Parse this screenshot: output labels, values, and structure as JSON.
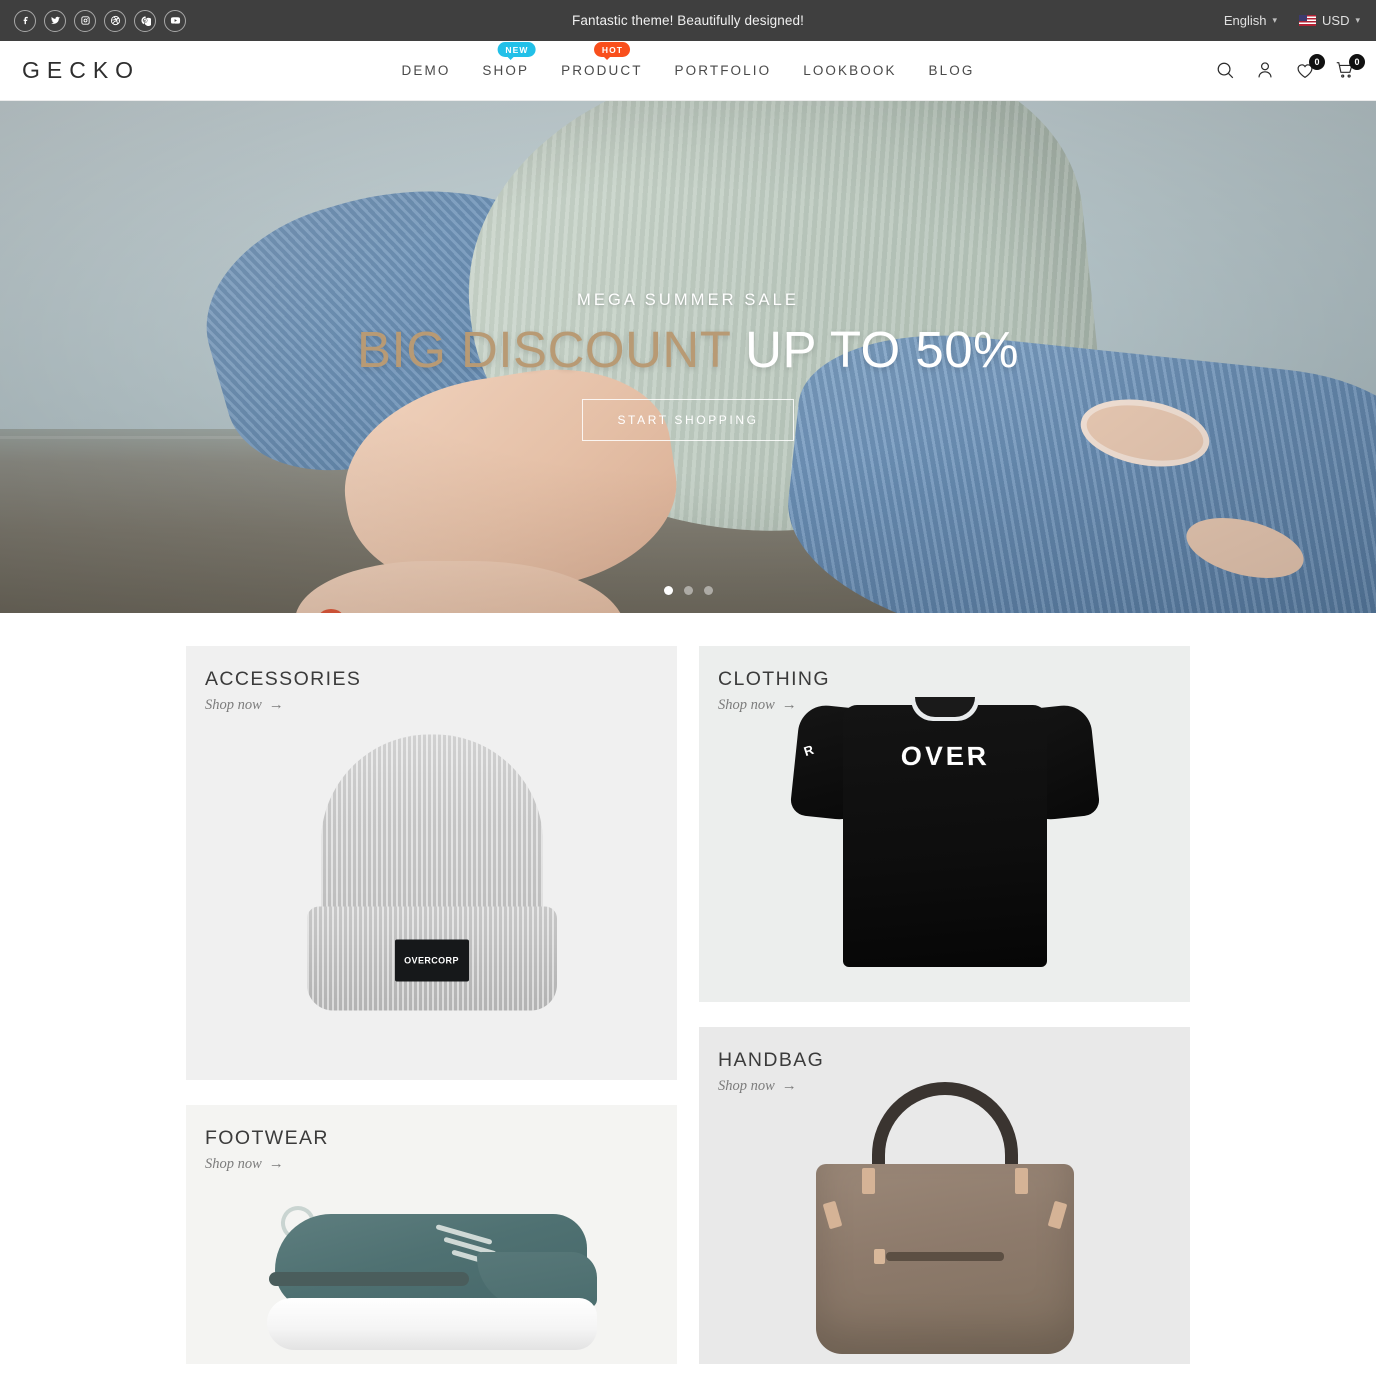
{
  "topbar": {
    "message": "Fantastic theme! Beautifully designed!",
    "social": [
      {
        "name": "facebook-icon",
        "label": "f"
      },
      {
        "name": "twitter-icon",
        "label": "t"
      },
      {
        "name": "instagram-icon",
        "label": "ig"
      },
      {
        "name": "dribbble-icon",
        "label": "d"
      },
      {
        "name": "pinterest-icon",
        "label": "p"
      },
      {
        "name": "youtube-icon",
        "label": "yt"
      }
    ],
    "language": "English",
    "currency": "USD",
    "bg_color": "#3f3f3f"
  },
  "header": {
    "logo": "GECKO",
    "nav": [
      {
        "label": "DEMO",
        "badge": null
      },
      {
        "label": "SHOP",
        "badge": "NEW",
        "badge_color": "#22c0e8"
      },
      {
        "label": "PRODUCT",
        "badge": "HOT",
        "badge_color": "#f94f1c"
      },
      {
        "label": "PORTFOLIO",
        "badge": null
      },
      {
        "label": "LOOKBOOK",
        "badge": null
      },
      {
        "label": "BLOG",
        "badge": null
      }
    ],
    "icons": [
      {
        "name": "search-icon",
        "count": null
      },
      {
        "name": "account-icon",
        "count": null
      },
      {
        "name": "wishlist-heart-icon",
        "count": "0"
      },
      {
        "name": "cart-icon",
        "count": "0"
      }
    ]
  },
  "hero": {
    "subtitle": "MEGA SUMMER SALE",
    "title_accent": "BIG DISCOUNT",
    "title_main": "UP TO 50%",
    "button": "START SHOPPING",
    "accent_color": "#b89a74",
    "slides": 3,
    "active_slide": 1
  },
  "categories": [
    {
      "title": "ACCESSORIES",
      "link": "Shop now",
      "arrow": "→",
      "bg": "#f0f0f0",
      "product": "gray-beanie",
      "product_label": "OVERCORP"
    },
    {
      "title": "CLOTHING",
      "link": "Shop now",
      "arrow": "→",
      "bg": "#eceeed",
      "product": "black-tshirt",
      "product_label": "OVER",
      "product_sleeve_label": "R"
    },
    {
      "title": "FOOTWEAR",
      "link": "Shop now",
      "arrow": "→",
      "bg": "#f4f4f2",
      "product": "teal-sneaker"
    },
    {
      "title": "HANDBAG",
      "link": "Shop now",
      "arrow": "→",
      "bg": "#e9e9e9",
      "product": "taupe-handbag"
    }
  ]
}
